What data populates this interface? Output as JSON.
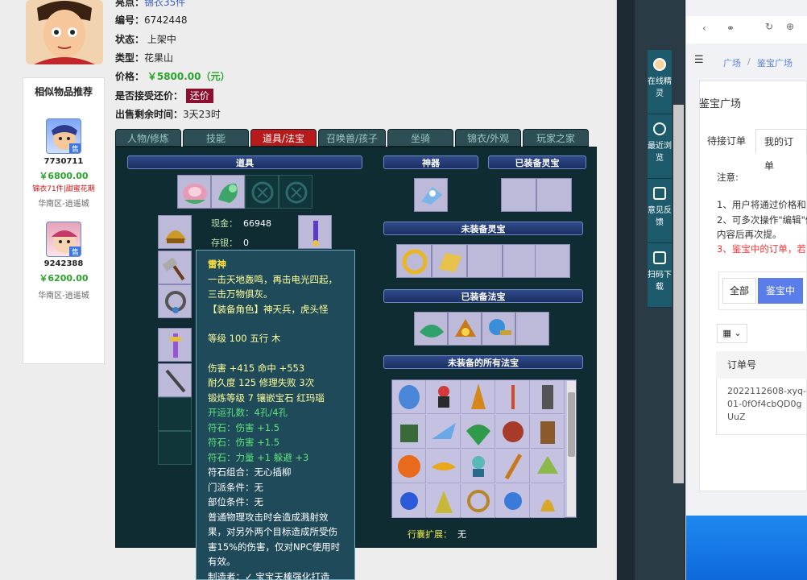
{
  "item": {
    "cut_label": "亮点：",
    "cut_value": "锦衣35件",
    "id_label": "编号：",
    "id_value": "6742448",
    "status_label": "状态：",
    "status_value": "上架中",
    "type_label": "类型：",
    "type_value": "花果山",
    "price_label": "价格：",
    "price_value": "￥5800.00（元）",
    "bargain_label": "是否接受还价：",
    "bargain_btn": "还价",
    "time_label": "出售剩余时间：",
    "time_value": "3天23时"
  },
  "similar": {
    "title": "相似物品推荐",
    "items": [
      {
        "id": "7730711",
        "price": "￥6800.00",
        "tag": "锦衣71件|甜蜜花期",
        "server": "华南区-逍遥城",
        "badge": "售"
      },
      {
        "id": "9242388",
        "price": "￥6200.00",
        "tag": "",
        "server": "华南区-逍遥城",
        "badge": "售"
      }
    ]
  },
  "tabs": [
    "人物/修炼",
    "技能",
    "道具/法宝",
    "召唤兽/孩子",
    "坐骑",
    "锦衣/外观",
    "玩家之家"
  ],
  "panel": {
    "items_header": "道具",
    "divine_header": "神器",
    "spirit_equipped_header": "已装备灵宝",
    "spirit_unequipped_header": "未装备灵宝",
    "fabao_equipped_header": "已装备法宝",
    "fabao_all_header": "未装备的所有法宝",
    "cash_label": "现金：",
    "cash_value": "66948",
    "deposit_label": "存银：",
    "deposit_value": "0",
    "bag_label": "行囊扩展：",
    "bag_value": "无"
  },
  "tooltip": {
    "name": "雷神",
    "desc": "一击天地轰鸣，再击电光四起，三击万物俱灰。",
    "role": "【装备角色】神天兵，虎头怪",
    "level": "等级 100 五行 木",
    "dmg": "伤害 +415 命中 +553",
    "dur": "耐久度 125 修理失败 3次",
    "forge": "锻炼等级 7 镶嵌宝石 红玛瑙",
    "holes": "开运孔数：4孔/4孔",
    "rune1": "符石：伤害 +1.5",
    "rune2": "符石：伤害 +1.5",
    "rune3": "符石：力量 +1 躲避 +3",
    "combo": "符石组合：无心插柳",
    "sect": "门派条件：无",
    "part": "部位条件：无",
    "effect": "普通物理攻击时会造成溅射效果，对另外两个目标造成所受伤害15%的伤害，仅对NPC使用时有效。",
    "maker": "制造者：✓ 宝宝天棒强化打造"
  },
  "floatbar": [
    {
      "label": "在线精灵"
    },
    {
      "label": "最近浏览"
    },
    {
      "label": "意见反馈"
    },
    {
      "label": "扫码下载"
    }
  ],
  "right": {
    "crumb1": "广场",
    "crumb_sep": "/",
    "crumb2": "鉴宝广场",
    "title": "鉴宝广场",
    "tab1": "待接订单",
    "tab2": "我的订单",
    "note_title": "注意:",
    "note1": "1、用户将通过价格和",
    "note2": "2、可多次操作\"编辑\"修",
    "note2b": "内容后再次提。",
    "note3": "3、鉴宝中的订单，若",
    "btn_all": "全部",
    "btn_mid": "鉴宝中",
    "table_header": "订单号",
    "order_no": "2022112608-xyq-01-0fOf4cbQD0gUuZ"
  },
  "colors": {
    "active_tab": "#b71a1a",
    "price": "#2aa32a",
    "panel_bg": "#0f2c33",
    "tooltip_bg": "#1f4a5a"
  }
}
